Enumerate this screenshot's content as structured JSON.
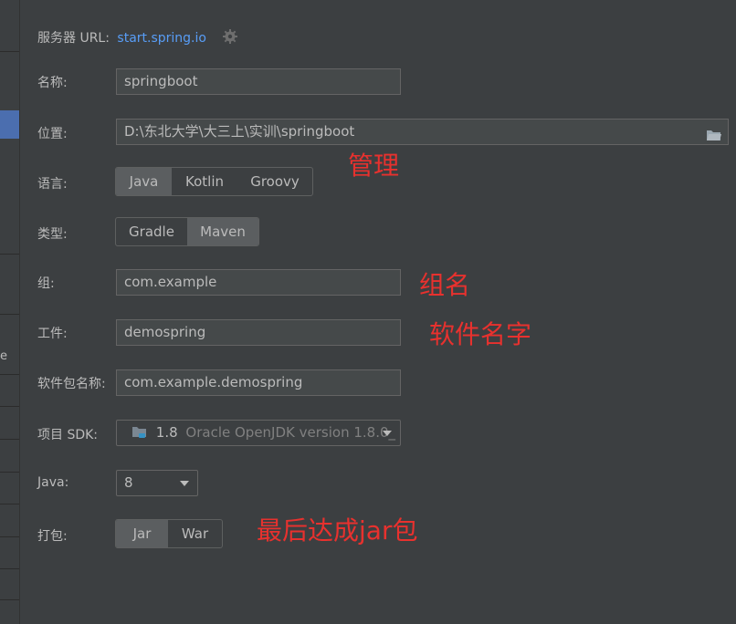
{
  "server": {
    "label": "服务器 URL:",
    "url": "start.spring.io",
    "settings_icon": "gear-icon"
  },
  "name": {
    "label": "名称:",
    "value": "springboot"
  },
  "location": {
    "label": "位置:",
    "value": "D:\\东北大学\\大三上\\实训\\springboot",
    "browse_icon": "folder-icon"
  },
  "language": {
    "label": "语言:",
    "options": [
      "Java",
      "Kotlin",
      "Groovy"
    ],
    "selected": "Java"
  },
  "type": {
    "label": "类型:",
    "options": [
      "Gradle",
      "Maven"
    ],
    "selected": "Maven"
  },
  "group": {
    "label": "组:",
    "value": "com.example"
  },
  "artifact": {
    "label": "工件:",
    "value": "demospring"
  },
  "package": {
    "label": "软件包名称:",
    "value": "com.example.demospring"
  },
  "sdk": {
    "label": "项目 SDK:",
    "version": "1.8",
    "description": "Oracle OpenJDK version 1.8.0_",
    "icon": "jdk-folder-icon"
  },
  "java": {
    "label": "Java:",
    "value": "8"
  },
  "packaging": {
    "label": "打包:",
    "options": [
      "Jar",
      "War"
    ],
    "selected": "Jar"
  },
  "annotations": {
    "manage": "管理",
    "group_name": "组名",
    "software_name": "软件名字",
    "final_jar": "最后达成jar包"
  },
  "colors": {
    "annotation": "#e8312e",
    "link": "#589df6",
    "selected_segment": "#5b5e60",
    "panel_bg": "#3c3f41"
  }
}
